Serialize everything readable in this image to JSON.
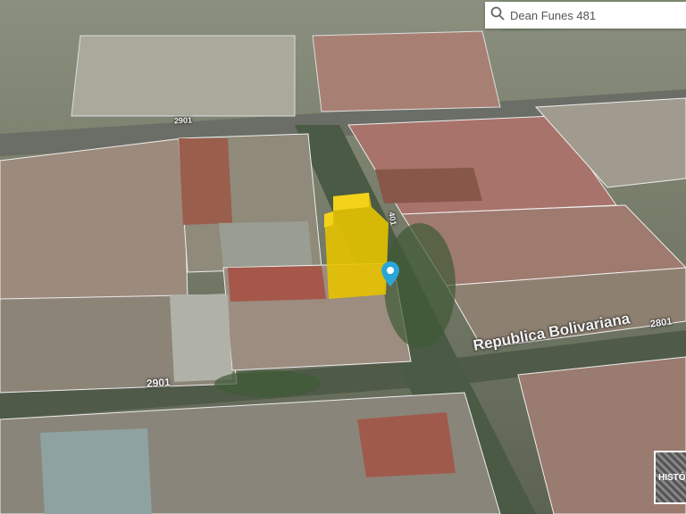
{
  "search": {
    "value": "Dean Funes 481",
    "icon": "search-icon"
  },
  "map": {
    "street_labels": [
      {
        "text": "2901",
        "id": "top"
      },
      {
        "text": "2901",
        "id": "bottom"
      },
      {
        "text": "2801",
        "id": "right"
      },
      {
        "text": "401",
        "id": "vertical"
      },
      {
        "text": "Republica Bolivariana",
        "id": "avenue"
      }
    ],
    "building_color": "#e6c200",
    "pin_color": "#2aa7d8"
  },
  "history_button": {
    "label": "HISTÓRICO"
  }
}
